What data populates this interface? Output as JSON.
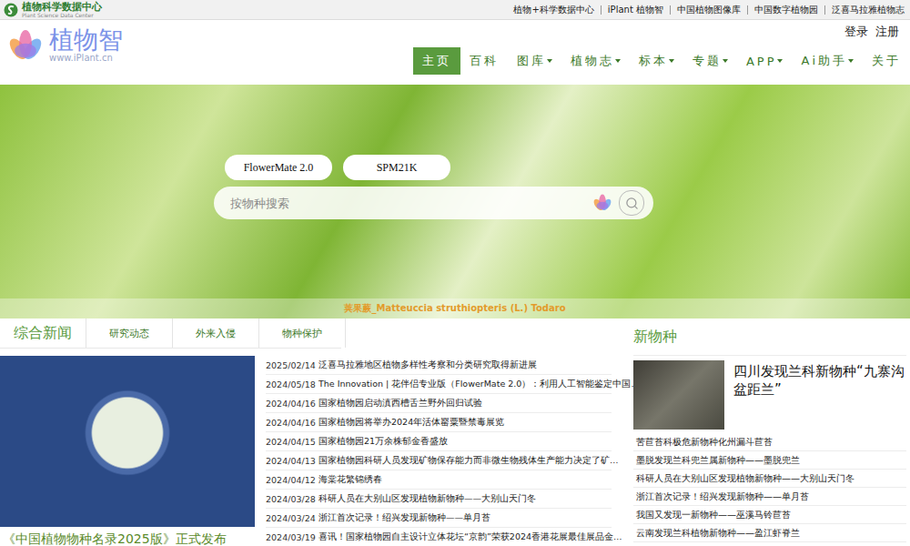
{
  "topbar": {
    "brand": "植物科学数据中心",
    "brand_sub": "Plant Science Data Center",
    "links": [
      "植物+科学数据中心",
      "iPlant 植物智",
      "中国植物图像库",
      "中国数字植物园",
      "泛喜马拉雅植物志"
    ]
  },
  "header": {
    "logo": "植物智",
    "logo_url": "www.iPlant.cn",
    "auth": [
      "登录",
      "注册"
    ],
    "nav": [
      {
        "label": "主页",
        "selected": true,
        "dropdown": false
      },
      {
        "label": "百科",
        "selected": false,
        "dropdown": false
      },
      {
        "label": "图库",
        "selected": false,
        "dropdown": true
      },
      {
        "label": "植物志",
        "selected": false,
        "dropdown": true
      },
      {
        "label": "标本",
        "selected": false,
        "dropdown": true
      },
      {
        "label": "专题",
        "selected": false,
        "dropdown": true
      },
      {
        "label": "APP",
        "selected": false,
        "dropdown": true
      },
      {
        "label": "Ai助手",
        "selected": false,
        "dropdown": true
      },
      {
        "label": "关于",
        "selected": false,
        "dropdown": false
      }
    ]
  },
  "hero": {
    "quick_links": [
      "FlowerMate 2.0",
      "SPM21K"
    ],
    "search": {
      "placeholder": "按物种搜索"
    },
    "caption": "荚果蕨_Matteuccia struthiopteris (L.) Todaro"
  },
  "news": {
    "tabs": [
      {
        "label": "综合新闻",
        "selected": true
      },
      {
        "label": "研究动态",
        "selected": false
      },
      {
        "label": "外来入侵",
        "selected": false
      },
      {
        "label": "物种保护",
        "selected": false
      }
    ],
    "feature_caption": "《中国植物物种名录2025版》正式发布",
    "items": [
      {
        "date": "2025/02/14",
        "title": "泛喜马拉雅地区植物多样性考察和分类研究取得新进展"
      },
      {
        "date": "2024/05/18",
        "title": "The Innovation | 花伴侣专业版（FlowerMate 2.0）：利用人工智能鉴定中国…"
      },
      {
        "date": "2024/04/16",
        "title": "国家植物园启动滇西槽舌兰野外回归试验"
      },
      {
        "date": "2024/04/16",
        "title": "国家植物园将举办2024年活体罂粟暨禁毒展览"
      },
      {
        "date": "2024/04/15",
        "title": "国家植物园21万余株郁金香盛放"
      },
      {
        "date": "2024/04/13",
        "title": "国家植物园科研人员发现矿物保存能力而非微生物残体生产能力决定了矿…"
      },
      {
        "date": "2024/04/12",
        "title": "海棠花繁锦绣春"
      },
      {
        "date": "2024/03/28",
        "title": "科研人员在大别山区发现植物新物种——大别山天门冬"
      },
      {
        "date": "2024/03/24",
        "title": "浙江首次记录！绍兴发现新物种——单月苔"
      },
      {
        "date": "2024/03/19",
        "title": "喜讯！国家植物园自主设计立体花坛“京韵”荣获2024香港花展最佳展品金…"
      }
    ]
  },
  "new_species": {
    "title": "新物种",
    "feature_title": "四川发现兰科新物种“九寨沟盆距兰”",
    "items": [
      "苦苣苔科极危新物种化州漏斗苣苔",
      "墨脱发现兰科兜兰属新物种——墨脱兜兰",
      "科研人员在大别山区发现植物新物种——大别山天门冬",
      "浙江首次记录！绍兴发现新物种——单月苔",
      "我国又发现一新物种——巫溪马铃苣苔",
      "云南发现兰科植物新物种——盈江虾脊兰"
    ]
  }
}
